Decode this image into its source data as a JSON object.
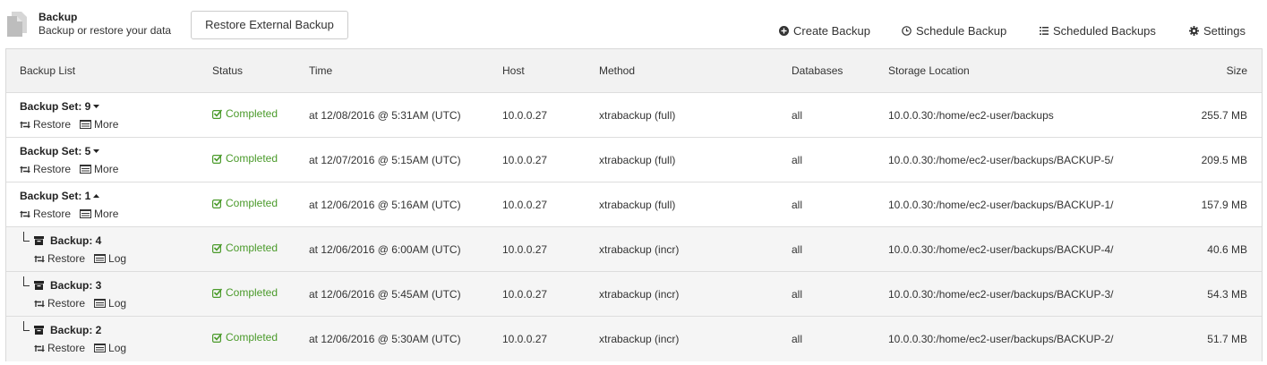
{
  "header": {
    "title": "Backup",
    "subtitle": "Backup or restore your data",
    "restore_external_label": "Restore External Backup",
    "actions": {
      "create_label": "Create Backup",
      "schedule_label": "Schedule Backup",
      "scheduled_label": "Scheduled Backups",
      "settings_label": "Settings"
    }
  },
  "table": {
    "columns": {
      "backup_list": "Backup List",
      "status": "Status",
      "time": "Time",
      "host": "Host",
      "method": "Method",
      "databases": "Databases",
      "storage": "Storage Location",
      "size": "Size"
    },
    "status_color": "#4a9a2a",
    "rows": [
      {
        "name": "Backup Set: 9",
        "action1": "Restore",
        "action2": "More",
        "status": "Completed",
        "time": "at 12/08/2016 @ 5:31AM (UTC)",
        "host": "10.0.0.27",
        "method": "xtrabackup (full)",
        "databases": "all",
        "storage": "10.0.0.30:/home/ec2-user/backups",
        "size": "255.7 MB"
      },
      {
        "name": "Backup Set: 5",
        "action1": "Restore",
        "action2": "More",
        "status": "Completed",
        "time": "at 12/07/2016 @ 5:15AM (UTC)",
        "host": "10.0.0.27",
        "method": "xtrabackup (full)",
        "databases": "all",
        "storage": "10.0.0.30:/home/ec2-user/backups/BACKUP-5/",
        "size": "209.5 MB"
      },
      {
        "name": "Backup Set: 1",
        "action1": "Restore",
        "action2": "More",
        "status": "Completed",
        "time": "at 12/06/2016 @ 5:16AM (UTC)",
        "host": "10.0.0.27",
        "method": "xtrabackup (full)",
        "databases": "all",
        "storage": "10.0.0.30:/home/ec2-user/backups/BACKUP-1/",
        "size": "157.9 MB"
      },
      {
        "name": "Backup: 4",
        "action1": "Restore",
        "action2": "Log",
        "status": "Completed",
        "time": "at 12/06/2016 @ 6:00AM (UTC)",
        "host": "10.0.0.27",
        "method": "xtrabackup (incr)",
        "databases": "all",
        "storage": "10.0.0.30:/home/ec2-user/backups/BACKUP-4/",
        "size": "40.6 MB"
      },
      {
        "name": "Backup: 3",
        "action1": "Restore",
        "action2": "Log",
        "status": "Completed",
        "time": "at 12/06/2016 @ 5:45AM (UTC)",
        "host": "10.0.0.27",
        "method": "xtrabackup (incr)",
        "databases": "all",
        "storage": "10.0.0.30:/home/ec2-user/backups/BACKUP-3/",
        "size": "54.3 MB"
      },
      {
        "name": "Backup: 2",
        "action1": "Restore",
        "action2": "Log",
        "status": "Completed",
        "time": "at 12/06/2016 @ 5:30AM (UTC)",
        "host": "10.0.0.27",
        "method": "xtrabackup (incr)",
        "databases": "all",
        "storage": "10.0.0.30:/home/ec2-user/backups/BACKUP-2/",
        "size": "51.7 MB"
      }
    ]
  }
}
